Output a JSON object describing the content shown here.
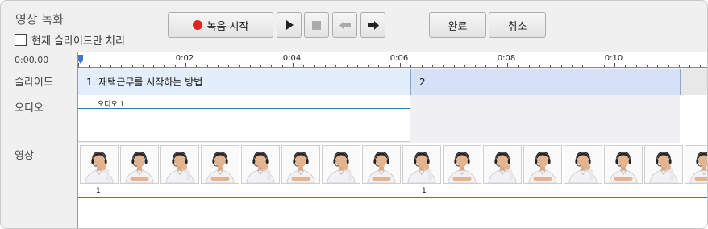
{
  "window": {
    "title": "영상 녹화",
    "slide_only_checkbox": {
      "label": "현재 슬라이드만 처리",
      "checked": false
    }
  },
  "toolbar": {
    "record_label": "녹음 시작",
    "play_icon": "play-icon",
    "stop_icon": "stop-icon",
    "prev_icon": "arrow-left-icon",
    "next_icon": "arrow-right-icon",
    "done_label": "완료",
    "cancel_label": "취소",
    "record_color": "#e0241b"
  },
  "tracks": {
    "current_time": "0:00.00",
    "slides_label": "슬라이드",
    "audio_label": "오디오",
    "video_label": "영상"
  },
  "ruler": {
    "labels": [
      "0:02",
      "0:04",
      "0:06",
      "0:08",
      "0:10"
    ]
  },
  "slides": [
    {
      "label": "1. 재택근무를 시작하는 방법",
      "color": "#e3eefc"
    },
    {
      "label": "2.",
      "color": "#d4e1f7"
    }
  ],
  "audio": {
    "clip_label": "오디오 1"
  },
  "video": {
    "frame_count": 16,
    "frame_numbers": [
      "1",
      "1"
    ]
  }
}
